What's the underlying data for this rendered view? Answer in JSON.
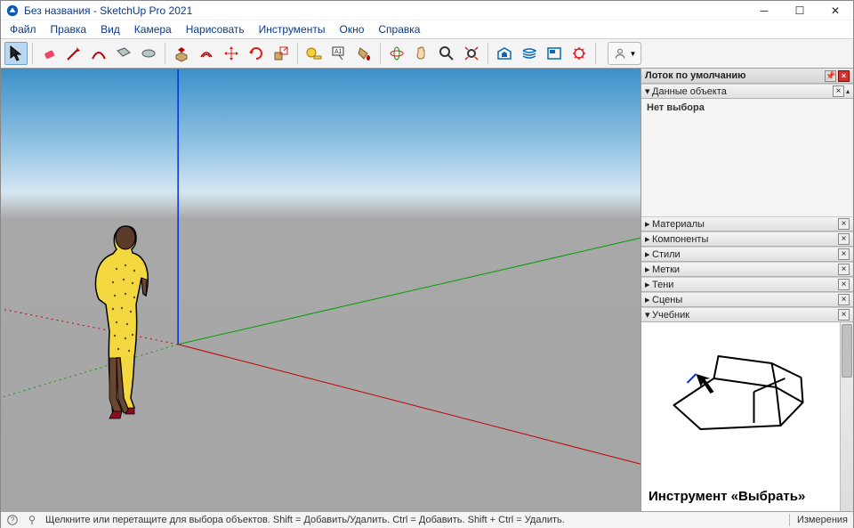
{
  "title": "Без названия - SketchUp Pro 2021",
  "menu": [
    "Файл",
    "Правка",
    "Вид",
    "Камера",
    "Нарисовать",
    "Инструменты",
    "Окно",
    "Справка"
  ],
  "toolbar": [
    {
      "name": "select",
      "alt": "Select"
    },
    {
      "name": "eraser",
      "alt": "Eraser"
    },
    {
      "name": "line",
      "alt": "Line"
    },
    {
      "name": "arc",
      "alt": "Arc"
    },
    {
      "name": "rect",
      "alt": "Rectangle"
    },
    {
      "name": "circle",
      "alt": "Circle"
    },
    {
      "name": "pushpull",
      "alt": "Push/Pull"
    },
    {
      "name": "offset",
      "alt": "Offset"
    },
    {
      "name": "move",
      "alt": "Move"
    },
    {
      "name": "rotate",
      "alt": "Rotate"
    },
    {
      "name": "scale",
      "alt": "Scale"
    },
    {
      "name": "tape",
      "alt": "Tape Measure"
    },
    {
      "name": "text",
      "alt": "Text"
    },
    {
      "name": "paint",
      "alt": "Paint Bucket"
    },
    {
      "name": "orbit",
      "alt": "Orbit"
    },
    {
      "name": "pan",
      "alt": "Pan"
    },
    {
      "name": "zoom",
      "alt": "Zoom"
    },
    {
      "name": "zoom-extents",
      "alt": "Zoom Extents"
    },
    {
      "name": "warehouse",
      "alt": "3D Warehouse"
    },
    {
      "name": "ext-warehouse",
      "alt": "Extension Warehouse"
    },
    {
      "name": "layout",
      "alt": "LayOut"
    },
    {
      "name": "ext-manager",
      "alt": "Extension Manager"
    }
  ],
  "tray": {
    "header": "Лоток по умолчанию",
    "entity": {
      "label": "Данные объекта",
      "body": "Нет выбора"
    },
    "panels": [
      "Материалы",
      "Компоненты",
      "Стили",
      "Метки",
      "Тени",
      "Сцены",
      "Учебник"
    ],
    "instructor": {
      "title": "Инструмент «Выбрать»"
    }
  },
  "status": {
    "hint": "Щелкните или перетащите для выбора объектов. Shift = Добавить/Удалить. Ctrl = Добавить. Shift + Ctrl = Удалить.",
    "measure_label": "Измерения"
  }
}
